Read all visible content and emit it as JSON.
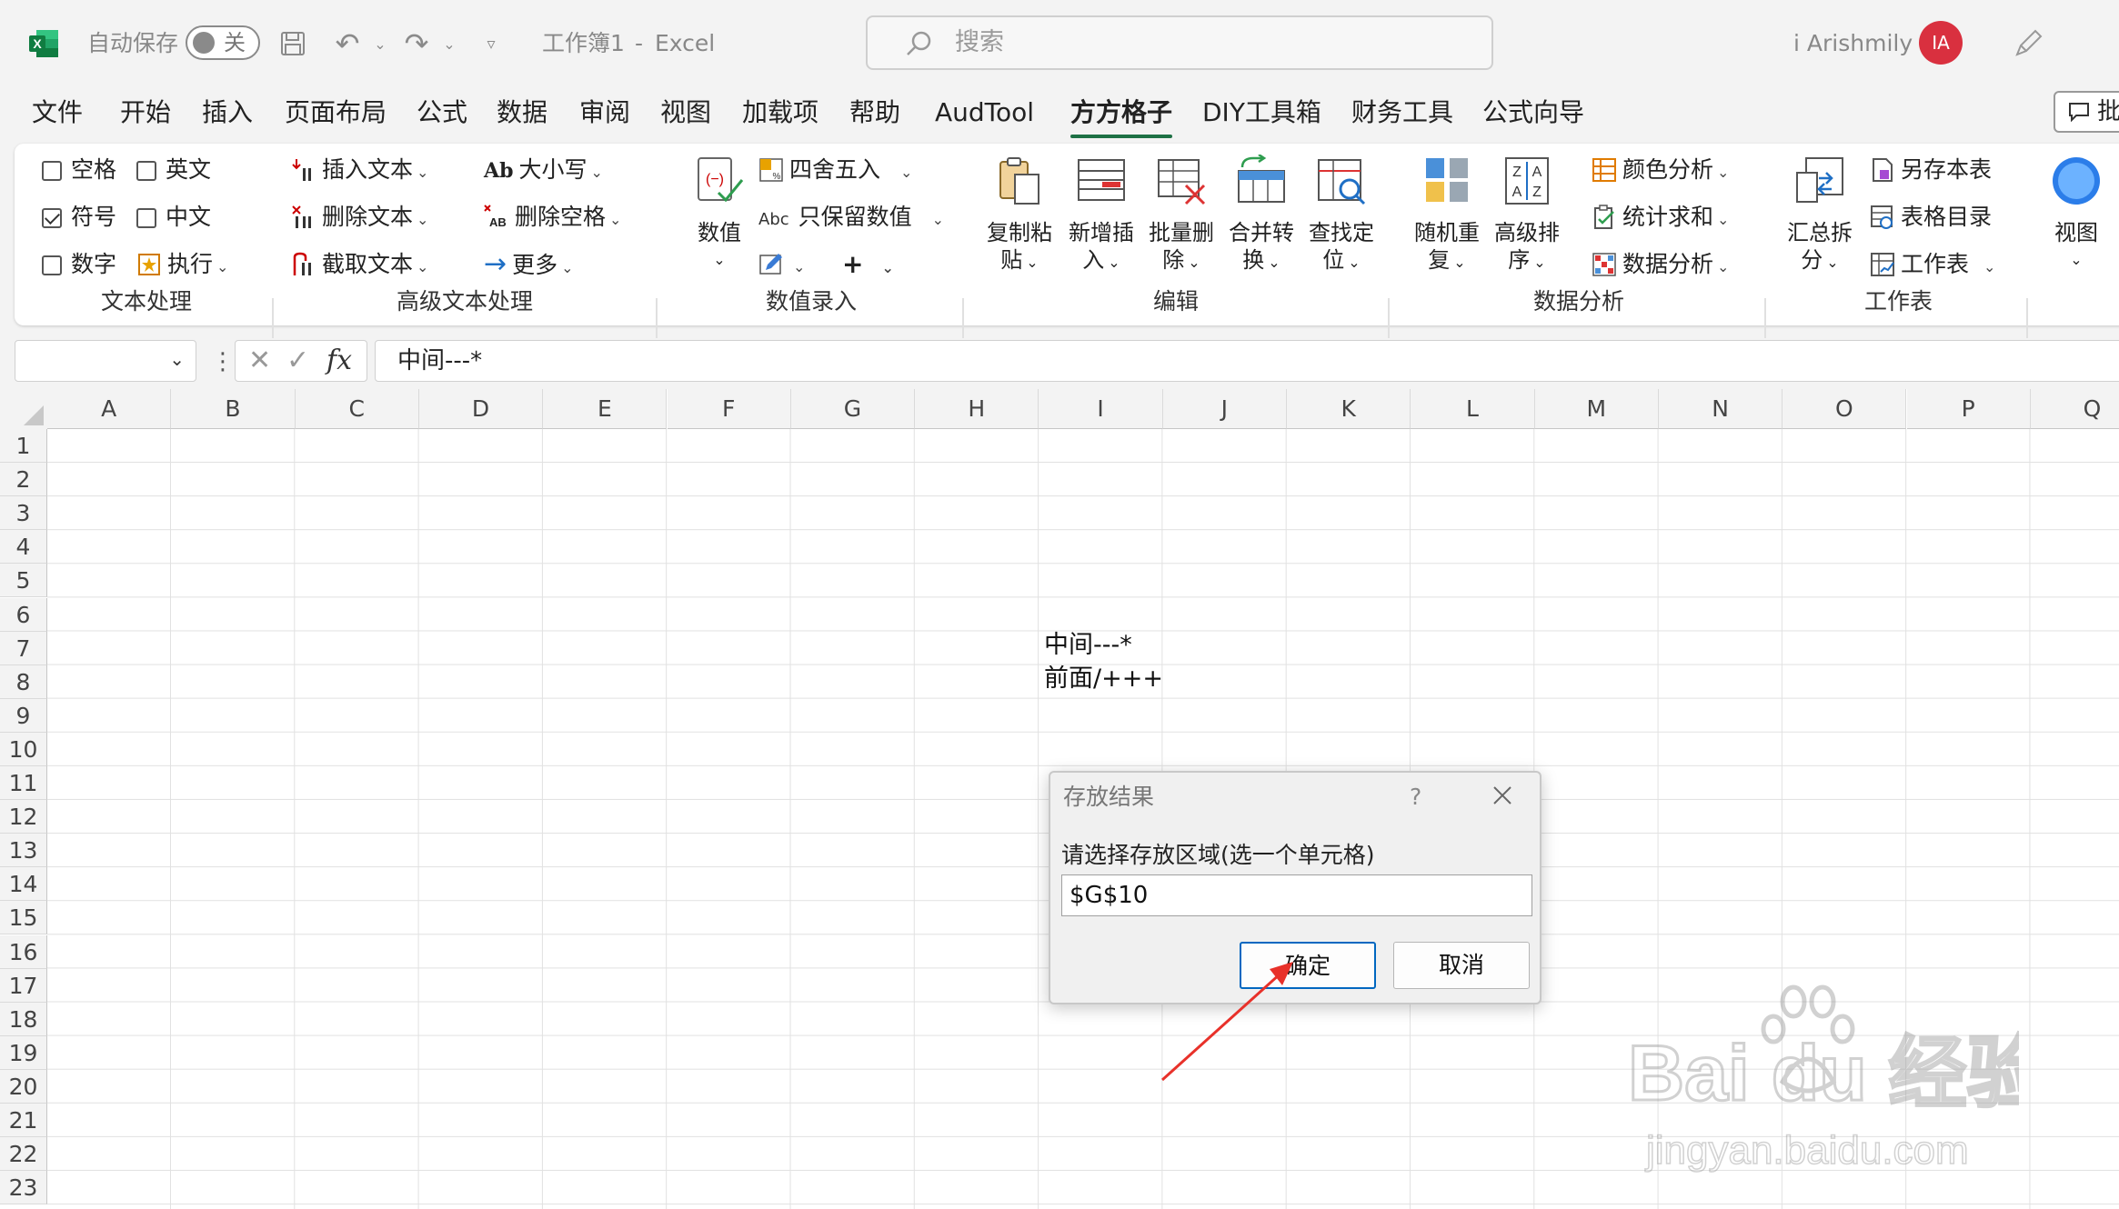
{
  "titlebar": {
    "autosave_label": "自动保存",
    "autosave_state": "关",
    "doc_title": "工作簿1",
    "separator": "-",
    "app_name": "Excel",
    "search_placeholder": "搜索",
    "user_name": "i Arishmily",
    "avatar_initials": "IA"
  },
  "menu": {
    "tabs": [
      "文件",
      "开始",
      "插入",
      "页面布局",
      "公式",
      "数据",
      "审阅",
      "视图",
      "加载项",
      "帮助",
      "AudTool",
      "方方格子",
      "DIY工具箱",
      "财务工具",
      "公式向导"
    ],
    "active_tab": "方方格子",
    "comment_label": "批"
  },
  "ribbon": {
    "text_group": {
      "label": "文本处理",
      "items": [
        "空格",
        "英文",
        "符号",
        "中文",
        "数字",
        "执行"
      ],
      "checked": "符号"
    },
    "adv_text_group": {
      "label": "高级文本处理",
      "insert": "插入文本",
      "delete": "删除文本",
      "extract": "截取文本",
      "case": "大小写",
      "remove_space": "删除空格",
      "more": "更多"
    },
    "num_group": {
      "label": "数值录入",
      "value_btn": "数值",
      "round": "四舍五入",
      "keep_num": "只保留数值",
      "plus": "+"
    },
    "edit_group": {
      "label": "编辑",
      "copy_paste": [
        "复制粘",
        "贴"
      ],
      "insert_new": [
        "新增插",
        "入"
      ],
      "batch_del": [
        "批量删",
        "除"
      ],
      "merge": [
        "合并转",
        "换"
      ],
      "find": [
        "查找定",
        "位"
      ]
    },
    "analysis_group": {
      "label": "数据分析",
      "random": [
        "随机重",
        "复"
      ],
      "sort": [
        "高级排",
        "序"
      ],
      "color": "颜色分析",
      "stats": "统计求和",
      "data": "数据分析"
    },
    "sheet_group": {
      "label": "工作表",
      "summary": [
        "汇总拆",
        "分"
      ],
      "save_sheet": "另存本表",
      "toc": "表格目录",
      "sheet": "工作表"
    },
    "view_btn": "视图"
  },
  "formula_bar": {
    "cancel": "✕",
    "enter": "✓",
    "fx": "fx",
    "content": "中间---*"
  },
  "grid": {
    "columns": [
      "A",
      "B",
      "C",
      "D",
      "E",
      "F",
      "G",
      "H",
      "I",
      "J",
      "K",
      "L",
      "M",
      "N",
      "O",
      "P",
      "Q"
    ],
    "rows": [
      "1",
      "2",
      "3",
      "4",
      "5",
      "6",
      "7",
      "8",
      "9",
      "10",
      "11",
      "12",
      "13",
      "14",
      "15",
      "16",
      "17",
      "18",
      "19",
      "20",
      "21",
      "22",
      "23"
    ],
    "cells": {
      "I7": "中间---*",
      "I8": "前面/+++"
    }
  },
  "dialog": {
    "title": "存放结果",
    "help": "?",
    "prompt": "请选择存放区域(选一个单元格)",
    "value": "$G$10",
    "ok": "确定",
    "cancel": "取消"
  },
  "watermark": {
    "brand": "Bai du 经验",
    "url": "jingyan.baidu.com"
  }
}
